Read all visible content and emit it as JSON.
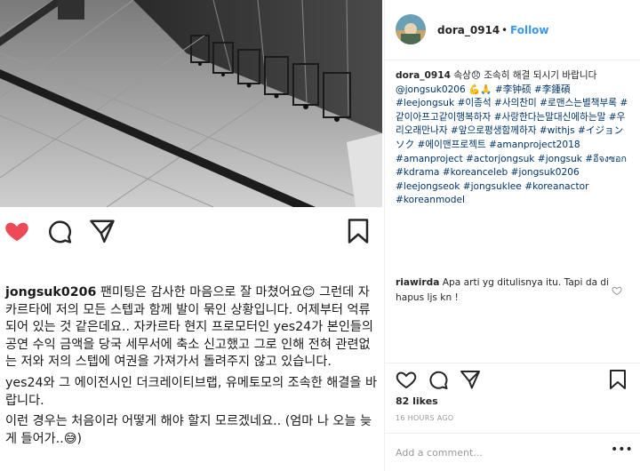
{
  "post": {
    "user": "dora_0914",
    "follow_label": "Follow",
    "separator": "•",
    "likes": "82 likes",
    "posted": "16 HOURS AGO",
    "add_comment_placeholder": "Add a comment...",
    "more_label": "•••"
  },
  "caption": {
    "user": "jongsuk0206",
    "para1": "팬미팅은 감사한 마음으로 잘 마쳤어요😊 그런데 자카르타에 저의 모든 스텝과 함께 발이 묶인 상황입니다. 어제부터 억류 되어 있는 것 같은데요.. 자카르타 현지 프로모터인 yes24가 본인들의 공연 수익 금액을 당국 세무서에 축소 신고했고 그로 인해 전혀 관련없는 저와 저의 스텝에 여권을 가져가서 돌려주지 않고 있습니다.",
    "para2": "yes24와 그 에이전시인 더크레이티브랩, 유메토모의 조속한 해결을 바랍니다.",
    "para3": "이런 경우는 처음이라 어떻게 해야 할지 모르겠네요.. (엄마 나 오늘 늦게 들어가..😅)"
  },
  "comments": [
    {
      "user": "dora_0914",
      "text": "속상😞 조속히 해결 되시기 바랍니다",
      "tags": "@jongsuk0206 💪🙏 #李钟硕 #李鍾碩 #leejongsuk #이종석 #사의찬미 #로맨스는별책부록 #같이아프고같이행복하자 #사랑한다는말대신에하는말 #우리오래만나자 #앞으로평생함께하자 #withjs #イジョンソク #에이맨프로젝트 #amanproject2018 #amanproject #actorjongsuk #jongsuk #อีจงซอก #kdrama #koreanceleb #jongsuk0206 #leejongseok #jongsuklee #koreanactor #koreanmodel"
    },
    {
      "user": "riawirda",
      "text": "Apa arti yg ditulisnya itu. Tapi da di hapus ljs kn !"
    }
  ],
  "icons": {
    "like": "heart-filled-icon",
    "comment": "speech-bubble-icon",
    "share": "paper-plane-icon",
    "save": "bookmark-icon"
  },
  "colors": {
    "like_red": "#ed4956",
    "follow_blue": "#3897f0",
    "hashtag": "#003569"
  }
}
